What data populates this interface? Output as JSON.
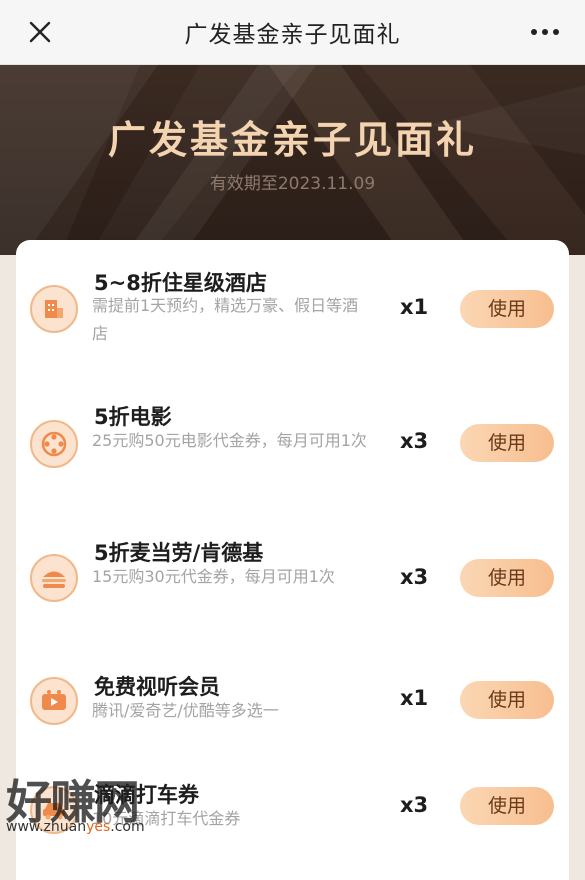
{
  "nav": {
    "title": "广发基金亲子见面礼",
    "close_icon": "close-icon",
    "more_icon": "more-icon"
  },
  "banner": {
    "title": "广发基金亲子见面礼",
    "validity": "有效期至2023.11.09"
  },
  "items": [
    {
      "icon": "hotel-icon",
      "title": "5~8折住星级酒店",
      "desc": "需提前1天预约，精选万豪、假日等酒店",
      "qty": "x1",
      "button": "使用"
    },
    {
      "icon": "film-reel-icon",
      "title": "5折电影",
      "desc": "25元购50元电影代金券，每月可用1次",
      "qty": "x3",
      "button": "使用"
    },
    {
      "icon": "burger-icon",
      "title": "5折麦当劳/肯德基",
      "desc": "15元购30元代金券，每月可用1次",
      "qty": "x3",
      "button": "使用"
    },
    {
      "icon": "video-icon",
      "title": "免费视听会员",
      "desc": "腾讯/爱奇艺/优酷等多选一",
      "qty": "x1",
      "button": "使用"
    },
    {
      "icon": "car-icon",
      "title": "滴滴打车券",
      "desc": "10元滴滴打车代金券",
      "qty": "x3",
      "button": "使用"
    }
  ],
  "watermark": {
    "text": "好赚网",
    "url_prefix": "www.zhuan",
    "url_accent": "yes",
    "url_suffix": ".com"
  },
  "colors": {
    "accent": "#f7be8f",
    "banner_bg": "#2f211a",
    "banner_title": "#f3d3b0",
    "icon_bg": "#fbe3cf"
  }
}
